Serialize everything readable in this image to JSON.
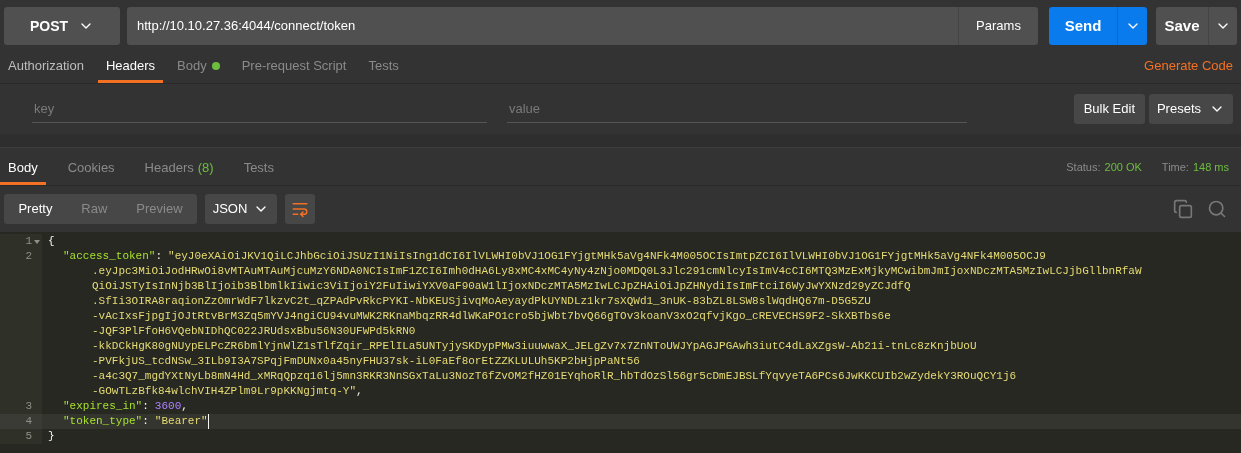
{
  "request": {
    "method": "POST",
    "url": "http://10.10.27.36:4044/connect/token",
    "params_button": "Params",
    "send_button": "Send",
    "save_button": "Save"
  },
  "request_tabs": [
    {
      "label": "Authorization",
      "selected": false,
      "dot": false
    },
    {
      "label": "Headers",
      "selected": true,
      "dot": false
    },
    {
      "label": "Body",
      "selected": false,
      "dot": true
    },
    {
      "label": "Pre-request Script",
      "selected": false,
      "dot": false
    },
    {
      "label": "Tests",
      "selected": false,
      "dot": false
    }
  ],
  "generate_code_link": "Generate Code",
  "headers_editor": {
    "key_placeholder": "key",
    "value_placeholder": "value",
    "bulk_edit_button": "Bulk Edit",
    "presets_button": "Presets"
  },
  "response_tabs": [
    {
      "label": "Body",
      "selected": true
    },
    {
      "label": "Cookies",
      "selected": false
    },
    {
      "label": "Headers",
      "selected": false,
      "count": "(8)"
    },
    {
      "label": "Tests",
      "selected": false
    }
  ],
  "status": {
    "status_label": "Status:",
    "status_value": "200 OK",
    "time_label": "Time:",
    "time_value": "148 ms"
  },
  "view_modes": [
    {
      "label": "Pretty",
      "selected": true
    },
    {
      "label": "Raw",
      "selected": false
    },
    {
      "label": "Preview",
      "selected": false
    }
  ],
  "format": "JSON",
  "code_lines": [
    {
      "number": "1",
      "kind": "punct",
      "text": "{",
      "foldable": true,
      "current": false
    },
    {
      "number": "2",
      "kind": "string_pair",
      "key": "\"access_token\"",
      "separator": ":",
      "foldable": false,
      "value_lines": [
        "\"eyJ0eXAiOiJKV1QiLCJhbGciOiJSUzI1NiIsIng1dCI6IlVLWHI0bVJ1OG1FYjgtMHk5aVg4NFk4M005OCIsImtpZCI6IlVLWHI0bVJ1OG1FYjgtMHk5aVg4NFk4M005OCJ9",
        ".eyJpc3MiOiJodHRwOi8vMTAuMTAuMjcuMzY6NDA0NCIsImF1ZCI6Imh0dHA6Ly8xMC4xMC4yNy4zNjo0MDQ0L3Jlc291cmNlcyIsImV4cCI6MTQ3MzExMjkyMCwibmJmIjoxNDczMTA5MzIwLCJjbGllbnRfaW",
        "QiOiJSTyIsInNjb3BlIjoib3BlbmlkIiwic3ViIjoiY2FuIiwiYXV0aF90aW1lIjoxNDczMTA5MzIwLCJpZHAiOiJpZHNydiIsImFtciI6WyJwYXNzd29yZCJdfQ",
        ".SfIi3OIRA8raqionZzOmrWdF7lkzvC2t_qZPAdPvRkcPYKI-NbKEUSjivqMoAeyaydPkUYNDLz1kr7sXQWd1_3nUK-83bZL8LSW8slWqdHQ67m-D5G5ZU",
        "-vAcIxsFjpgIjOJtRtvBrM3Zq5mYVJ4ngiCU94vuMWK2RKnaMbqzRR4dlWKaPO1cro5bjWbt7bvQ66gTOv3koanV3xO2qfvjKgo_cREVECHS9F2-SkXBTbs6e",
        "-JQF3PlFfoH6VQebNIDhQC022JRUdsxBbu56N30UFWPd5kRN0",
        "-kkDCkHgK80gNUypELPcZR6bmlYjnWlZ1sTlfZqir_RPElILa5UNTyjySKDypPMw3iuuwwaX_JELgZv7x7ZnNToUWJYpAGJPGAwh3iutC4dLaXZgsW-Ab21i-tnLc8zKnjbUoU",
        "-PVFkjUS_tcdNSw_3ILb9I3A7SPqjFmDUNx0a45nyFHU37sk-iL0FaEf8orEtZZKLULUh5KP2bHjpPaNt56",
        "-a4c3Q7_mgdYXtNyLb8mN4Hd_xMRqQpzq16lj5mn3RKR3NnSGxTaLu3NozT6fZvOM2fHZ01EYqhoRlR_hbTdOzSl56gr5cDmEJBSLfYqvyeTA6PCs6JwKKCUIb2wZydekY3ROuQCY1j6",
        "-GOwTLzBfk84wlchVIH4ZPlm9Lr9pKKNgjmtq-Y\""
      ],
      "suffix": ",",
      "current": false
    },
    {
      "number": "3",
      "kind": "number_pair",
      "key": "\"expires_in\"",
      "separator": ":",
      "foldable": false,
      "value_lines": [
        "3600"
      ],
      "suffix": ",",
      "current": false
    },
    {
      "number": "4",
      "kind": "string_pair",
      "key": "\"token_type\"",
      "separator": ":",
      "foldable": false,
      "value_lines": [
        "\"Bearer\""
      ],
      "current": true
    },
    {
      "number": "5",
      "kind": "punct",
      "text": "}",
      "foldable": false,
      "current": false
    }
  ]
}
